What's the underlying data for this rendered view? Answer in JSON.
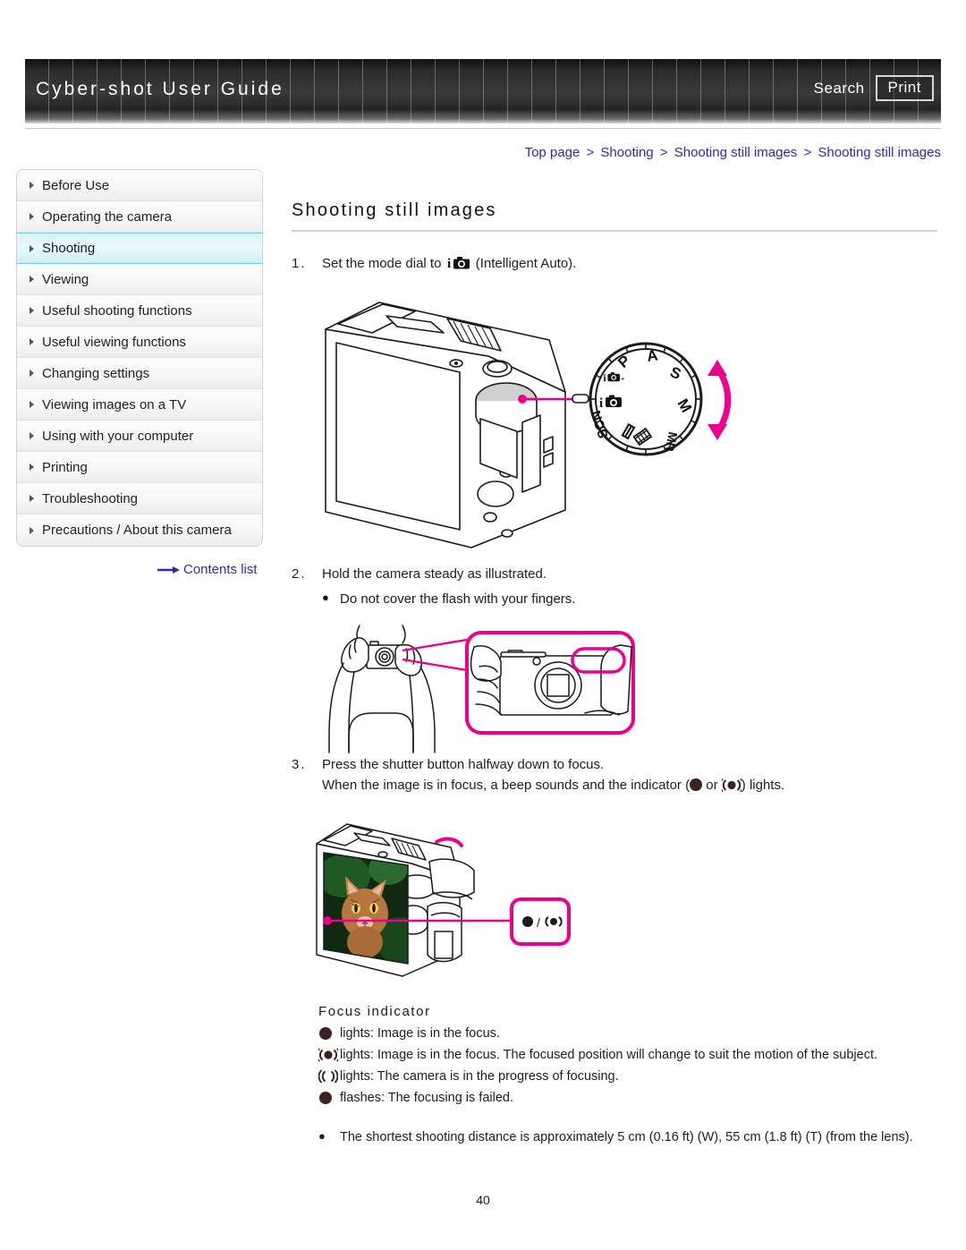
{
  "header": {
    "title": "Cyber-shot User Guide",
    "search_label": "Search",
    "print_label": "Print"
  },
  "breadcrumb": {
    "items": [
      "Top page",
      "Shooting",
      "Shooting still images",
      "Shooting still images"
    ],
    "separator": ">"
  },
  "sidebar": {
    "items": [
      {
        "label": "Before Use",
        "active": false
      },
      {
        "label": "Operating the camera",
        "active": false
      },
      {
        "label": "Shooting",
        "active": true
      },
      {
        "label": "Viewing",
        "active": false
      },
      {
        "label": "Useful shooting functions",
        "active": false
      },
      {
        "label": "Useful viewing functions",
        "active": false
      },
      {
        "label": "Changing settings",
        "active": false
      },
      {
        "label": "Viewing images on a TV",
        "active": false
      },
      {
        "label": "Using with your computer",
        "active": false
      },
      {
        "label": "Printing",
        "active": false
      },
      {
        "label": "Troubleshooting",
        "active": false
      },
      {
        "label": "Precautions / About this camera",
        "active": false
      }
    ],
    "contents_link": "Contents list"
  },
  "main": {
    "page_title": "Shooting still images",
    "steps": [
      {
        "number": "1.",
        "text_before_icon": "Set the mode dial to ",
        "icon": "intelligent-auto-icon",
        "text_after_icon": " (Intelligent Auto)."
      },
      {
        "number": "2.",
        "text": "Hold the camera steady as illustrated.",
        "bullet": "Do not cover the flash with your fingers."
      },
      {
        "number": "3.",
        "text": "Press the shutter button halfway down to focus.",
        "line2_a": "When the image is in focus, a beep sounds and the indicator (",
        "line2_or": " or ",
        "line2_b": ") lights."
      }
    ],
    "mode_dial": {
      "labels": [
        "P",
        "A",
        "S",
        "M",
        "MR",
        "SCN"
      ],
      "icon_labels": [
        "iAuto+",
        "iAuto",
        "panorama",
        "movie"
      ]
    },
    "focus_indicator": {
      "heading": "Focus indicator",
      "rows": [
        {
          "icon": "focus-solid-dot-icon",
          "text": "lights: Image is in the focus."
        },
        {
          "icon": "focus-tracking-icon",
          "text": "lights: Image is in the focus. The focused position will change to suit the motion of the subject."
        },
        {
          "icon": "focus-searching-icon",
          "text": "lights: The camera is in the progress of focusing."
        },
        {
          "icon": "focus-solid-dot-icon",
          "text": "flashes: The focusing is failed."
        }
      ]
    },
    "note": {
      "bullet_char": "●",
      "text": "The shortest shooting distance is approximately 5 cm (0.16 ft) (W), 55 cm (1.8 ft) (T) (from the lens)."
    },
    "callout_label": "● / ()"
  },
  "page_number": "40",
  "colors": {
    "link": "#2b2bbb",
    "accent_pink": "#ec008c",
    "sidebar_active": "#cdeef6",
    "header_dark": "#2b2b2b"
  }
}
